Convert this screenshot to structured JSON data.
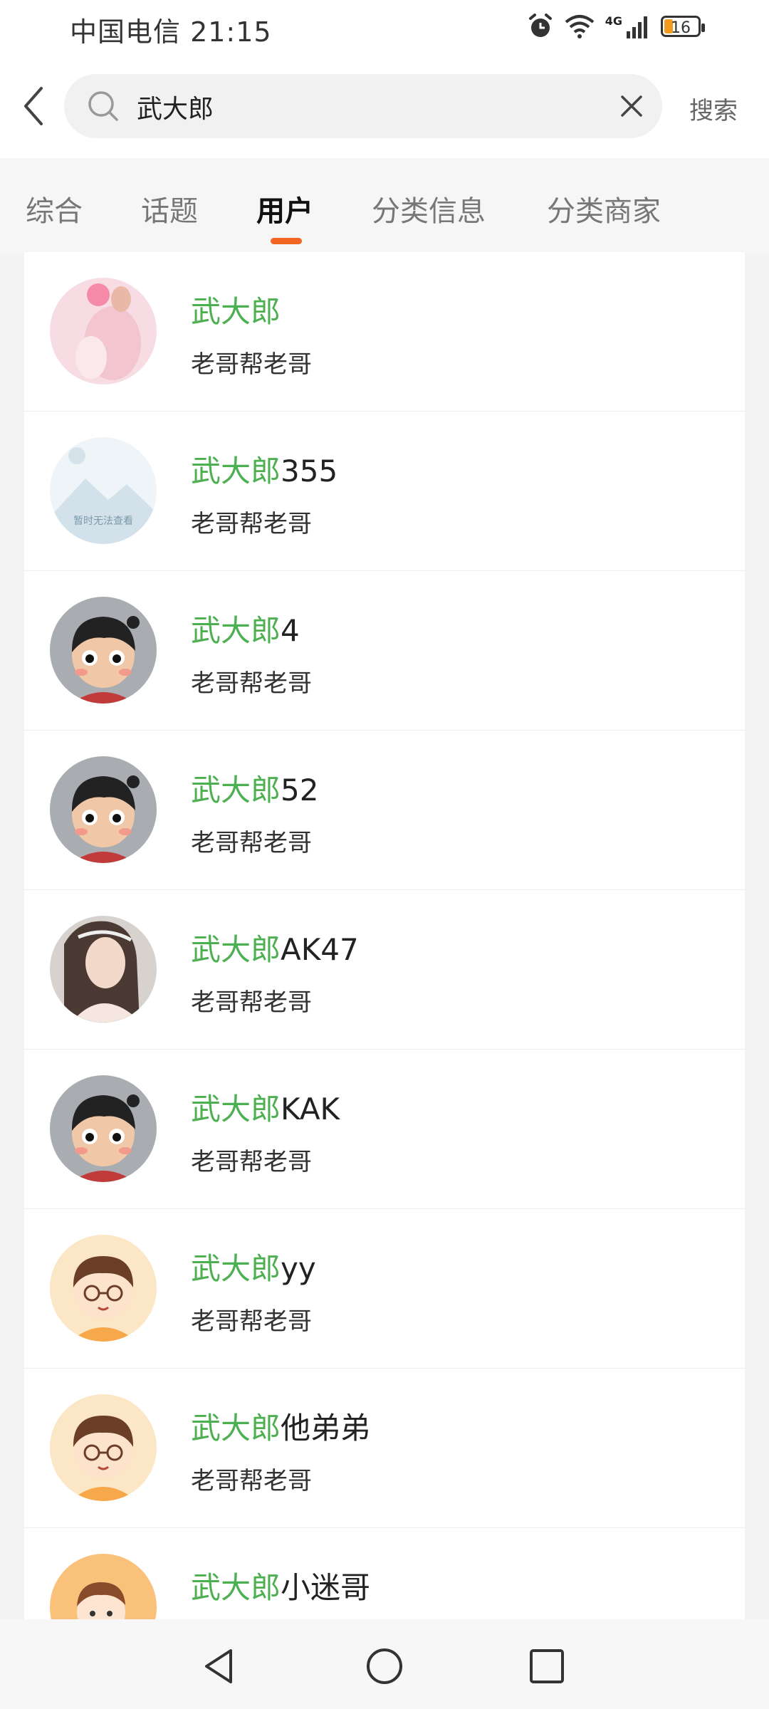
{
  "status_bar": {
    "carrier_time": "中国电信 21:15",
    "battery_level": "16",
    "network": "4G",
    "icons": [
      "alarm-icon",
      "wifi-icon",
      "signal-icon",
      "battery-icon"
    ]
  },
  "header": {
    "search_value": "武大郎",
    "search_button_label": "搜索",
    "icons": [
      "back-arrow-icon",
      "search-icon",
      "clear-icon"
    ]
  },
  "tabs": [
    {
      "label": "综合",
      "active": false
    },
    {
      "label": "话题",
      "active": false
    },
    {
      "label": "用户",
      "active": true
    },
    {
      "label": "分类信息",
      "active": false
    },
    {
      "label": "分类商家",
      "active": false
    }
  ],
  "colors": {
    "highlight": "#4caf50",
    "tab_indicator": "#f26522"
  },
  "users": [
    {
      "highlight": "武大郎",
      "rest": "",
      "subtitle": "老哥帮老哥",
      "avatar": "pink-photo-avatar"
    },
    {
      "highlight": "武大郎",
      "rest": "355",
      "subtitle": "老哥帮老哥",
      "avatar": "placeholder-avatar",
      "avatar_text": "暂时无法查看"
    },
    {
      "highlight": "武大郎",
      "rest": "4",
      "subtitle": "老哥帮老哥",
      "avatar": "cartoon-face-avatar"
    },
    {
      "highlight": "武大郎",
      "rest": "52",
      "subtitle": "老哥帮老哥",
      "avatar": "cartoon-face-avatar"
    },
    {
      "highlight": "武大郎",
      "rest": "AK47",
      "subtitle": "老哥帮老哥",
      "avatar": "woman-photo-avatar"
    },
    {
      "highlight": "武大郎",
      "rest": "KAK",
      "subtitle": "老哥帮老哥",
      "avatar": "cartoon-face-avatar"
    },
    {
      "highlight": "武大郎",
      "rest": "yy",
      "subtitle": "老哥帮老哥",
      "avatar": "glasses-boy-avatar"
    },
    {
      "highlight": "武大郎",
      "rest": "他弟弟",
      "subtitle": "老哥帮老哥",
      "avatar": "glasses-boy-avatar"
    },
    {
      "highlight": "武大郎",
      "rest": "小迷哥",
      "subtitle": "",
      "avatar": "cartoon-kid-avatar"
    }
  ],
  "nav_bar": {
    "icons": [
      "nav-back-icon",
      "nav-home-icon",
      "nav-recents-icon"
    ]
  }
}
